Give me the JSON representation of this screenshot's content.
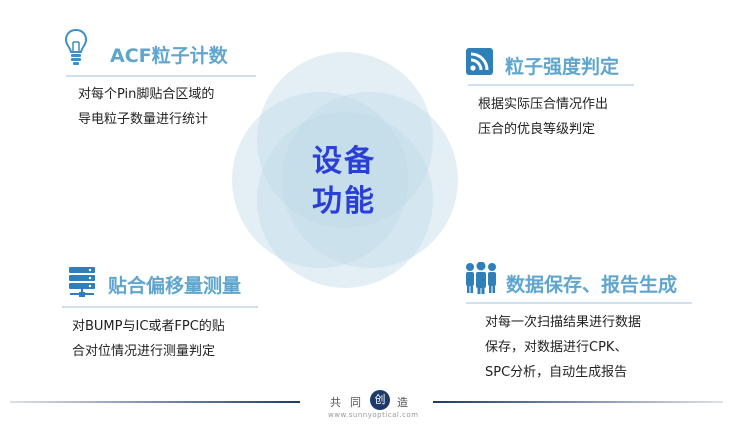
{
  "center": {
    "line1": "设备",
    "line2": "功能"
  },
  "features": {
    "acf": {
      "title": "ACF粒子计数",
      "icon": "lightbulb-icon",
      "desc1": "对每个Pin脚贴合区域的",
      "desc2": "导电粒子数量进行统计"
    },
    "strength": {
      "title": "粒子强度判定",
      "icon": "rss-feed-icon",
      "desc1": "根据实际压合情况作出",
      "desc2": "压合的优良等级判定"
    },
    "offset": {
      "title": "贴合偏移量测量",
      "icon": "server-network-icon",
      "desc1": "对BUMP与IC或者FPC的贴",
      "desc2": "合对位情况进行测量判定"
    },
    "report": {
      "title": "数据保存、报告生成",
      "icon": "people-group-icon",
      "desc1": "对每一次扫描结果进行数据",
      "desc2": "保存，对数据进行CPK、",
      "desc3": "SPC分析，自动生成报告"
    }
  },
  "footer": {
    "char1": "共",
    "char2": "同",
    "char3": "创",
    "char4": "造",
    "url": "www.sunnyoptical.com"
  },
  "colors": {
    "title_blue": "#5fa6cf",
    "center_blue": "#2a3fd8",
    "circle": "#bcd9e6",
    "footer_navy": "#1e3a6a"
  }
}
